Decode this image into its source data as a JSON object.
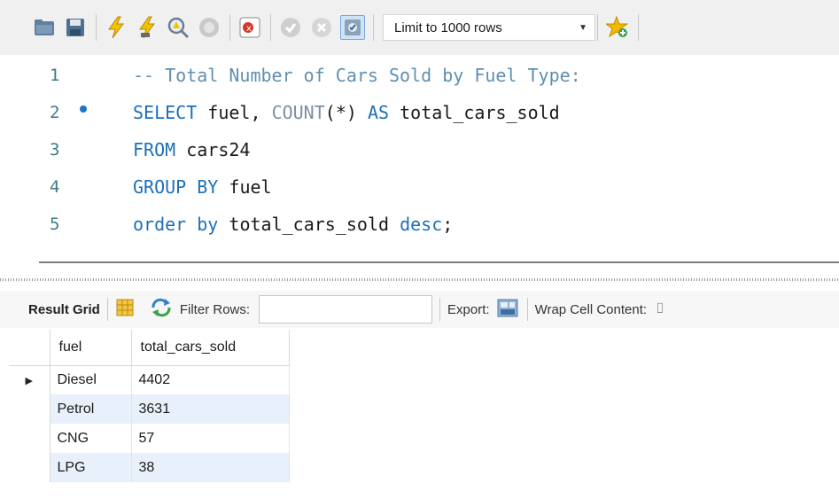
{
  "toolbar": {
    "buttons": [
      {
        "name": "open-folder-icon"
      },
      {
        "name": "save-icon"
      },
      {
        "name": "execute-icon"
      },
      {
        "name": "execute-current-icon"
      },
      {
        "name": "explain-icon"
      },
      {
        "name": "stop-icon"
      },
      {
        "name": "toggle-error-icon"
      },
      {
        "name": "commit-icon"
      },
      {
        "name": "rollback-icon"
      },
      {
        "name": "autocommit-icon"
      }
    ],
    "limit_label": "Limit to 1000 rows"
  },
  "editor": {
    "lines": [
      {
        "num": "1",
        "text": "-- Total Number of Cars Sold by Fuel Type:"
      },
      {
        "num": "2",
        "text": "SELECT fuel, COUNT(*) AS total_cars_sold"
      },
      {
        "num": "3",
        "text": "FROM cars24"
      },
      {
        "num": "4",
        "text": "GROUP BY fuel"
      },
      {
        "num": "5",
        "text": "order by total_cars_sold desc;"
      }
    ]
  },
  "result": {
    "title": "Result Grid",
    "filter_label": "Filter Rows:",
    "filter_value": "",
    "export_label": "Export:",
    "wrap_label": "Wrap Cell Content:",
    "columns": [
      "fuel",
      "total_cars_sold"
    ],
    "rows": [
      [
        "Diesel",
        "4402"
      ],
      [
        "Petrol",
        "3631"
      ],
      [
        "CNG",
        "57"
      ],
      [
        "LPG",
        "38"
      ]
    ]
  },
  "colors": {
    "keyword": "#1d6fb8",
    "comment": "#5f8fb0",
    "function": "#7a8fa3",
    "alt_row": "#e8f0fb"
  }
}
